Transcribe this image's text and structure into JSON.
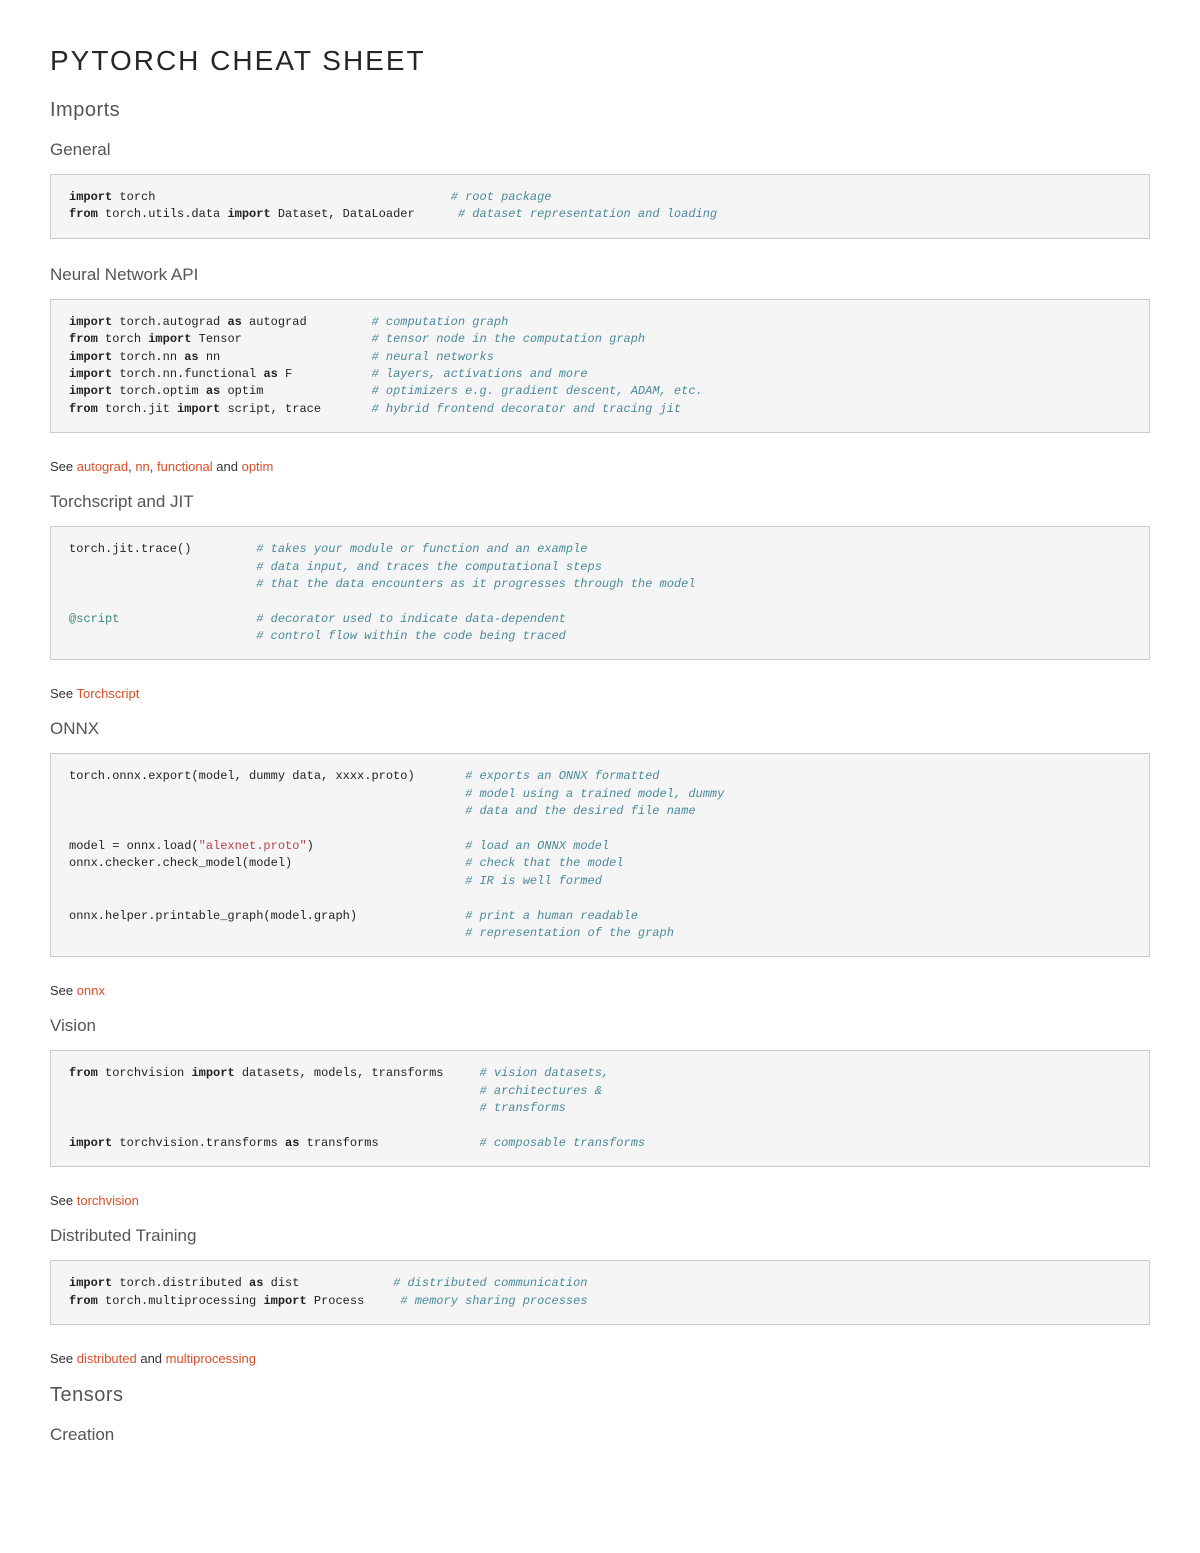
{
  "title": "PYTORCH CHEAT SHEET",
  "sections": {
    "imports": "Imports",
    "tensors": "Tensors"
  },
  "sub": {
    "general": "General",
    "nnapi": "Neural Network API",
    "tsjit": "Torchscript and JIT",
    "onnx": "ONNX",
    "vision": "Vision",
    "dist": "Distributed Training",
    "creation": "Creation"
  },
  "see": {
    "prefix": "See ",
    "and": " and ",
    "comma": ", ",
    "autograd": "autograd",
    "nn": "nn",
    "functional": "functional",
    "optim": "optim",
    "torchscript": "Torchscript",
    "onnx": "onnx",
    "torchvision": "torchvision",
    "distributed": "distributed",
    "multiprocessing": "multiprocessing"
  },
  "code": {
    "general": {
      "l1a": "import",
      "l1b": " torch                                         ",
      "c1": "# root package",
      "l2a": "from",
      "l2b": " torch.utils.data ",
      "l2c": "import",
      "l2d": " Dataset, DataLoader      ",
      "c2": "# dataset representation and loading"
    },
    "nnapi": {
      "l1a": "import",
      "l1b": " torch.autograd ",
      "l1c": "as",
      "l1d": " autograd         ",
      "c1": "# computation graph",
      "l2a": "from",
      "l2b": " torch ",
      "l2c": "import",
      "l2d": " Tensor                  ",
      "c2": "# tensor node in the computation graph",
      "l3a": "import",
      "l3b": " torch.nn ",
      "l3c": "as",
      "l3d": " nn                     ",
      "c3": "# neural networks",
      "l4a": "import",
      "l4b": " torch.nn.functional ",
      "l4c": "as",
      "l4d": " F           ",
      "c4": "# layers, activations and more",
      "l5a": "import",
      "l5b": " torch.optim ",
      "l5c": "as",
      "l5d": " optim               ",
      "c5": "# optimizers e.g. gradient descent, ADAM, etc.",
      "l6a": "from",
      "l6b": " torch.jit ",
      "l6c": "import",
      "l6d": " script, trace       ",
      "c6": "# hybrid frontend decorator and tracing jit"
    },
    "tsjit": {
      "l1": "torch.jit.trace()         ",
      "c1": "# takes your module or function and an example",
      "pad": "                          ",
      "c2": "# data input, and traces the computational steps",
      "c3": "# that the data encounters as it progresses through the model",
      "dec": "@script",
      "decpad": "                   ",
      "c4": "# decorator used to indicate data-dependent",
      "c5": "# control flow within the code being traced"
    },
    "onnx": {
      "l1": "torch.onnx.export(model, dummy data, xxxx.proto)       ",
      "c1": "# exports an ONNX formatted",
      "pad1": "                                                       ",
      "c2": "# model using a trained model, dummy",
      "c3": "# data and the desired file name",
      "l2a": "model = onnx.load(",
      "l2b": "\"alexnet.proto\"",
      "l2c": ")                     ",
      "c4": "# load an ONNX model",
      "l3": "onnx.checker.check_model(model)                        ",
      "c5": "# check that the model",
      "c6": "# IR is well formed",
      "l4": "onnx.helper.printable_graph(model.graph)               ",
      "c7": "# print a human readable",
      "c8": "# representation of the graph"
    },
    "vision": {
      "l1a": "from",
      "l1b": " torchvision ",
      "l1c": "import",
      "l1d": " datasets, models, transforms     ",
      "c1": "# vision datasets,",
      "pad": "                                                         ",
      "c2": "# architectures &",
      "c3": "# transforms",
      "l2a": "import",
      "l2b": " torchvision.transforms ",
      "l2c": "as",
      "l2d": " transforms              ",
      "c4": "# composable transforms"
    },
    "dist": {
      "l1a": "import",
      "l1b": " torch.distributed ",
      "l1c": "as",
      "l1d": " dist             ",
      "c1": "# distributed communication",
      "l2a": "from",
      "l2b": " torch.multiprocessing ",
      "l2c": "import",
      "l2d": " Process     ",
      "c2": "# memory sharing processes"
    }
  }
}
